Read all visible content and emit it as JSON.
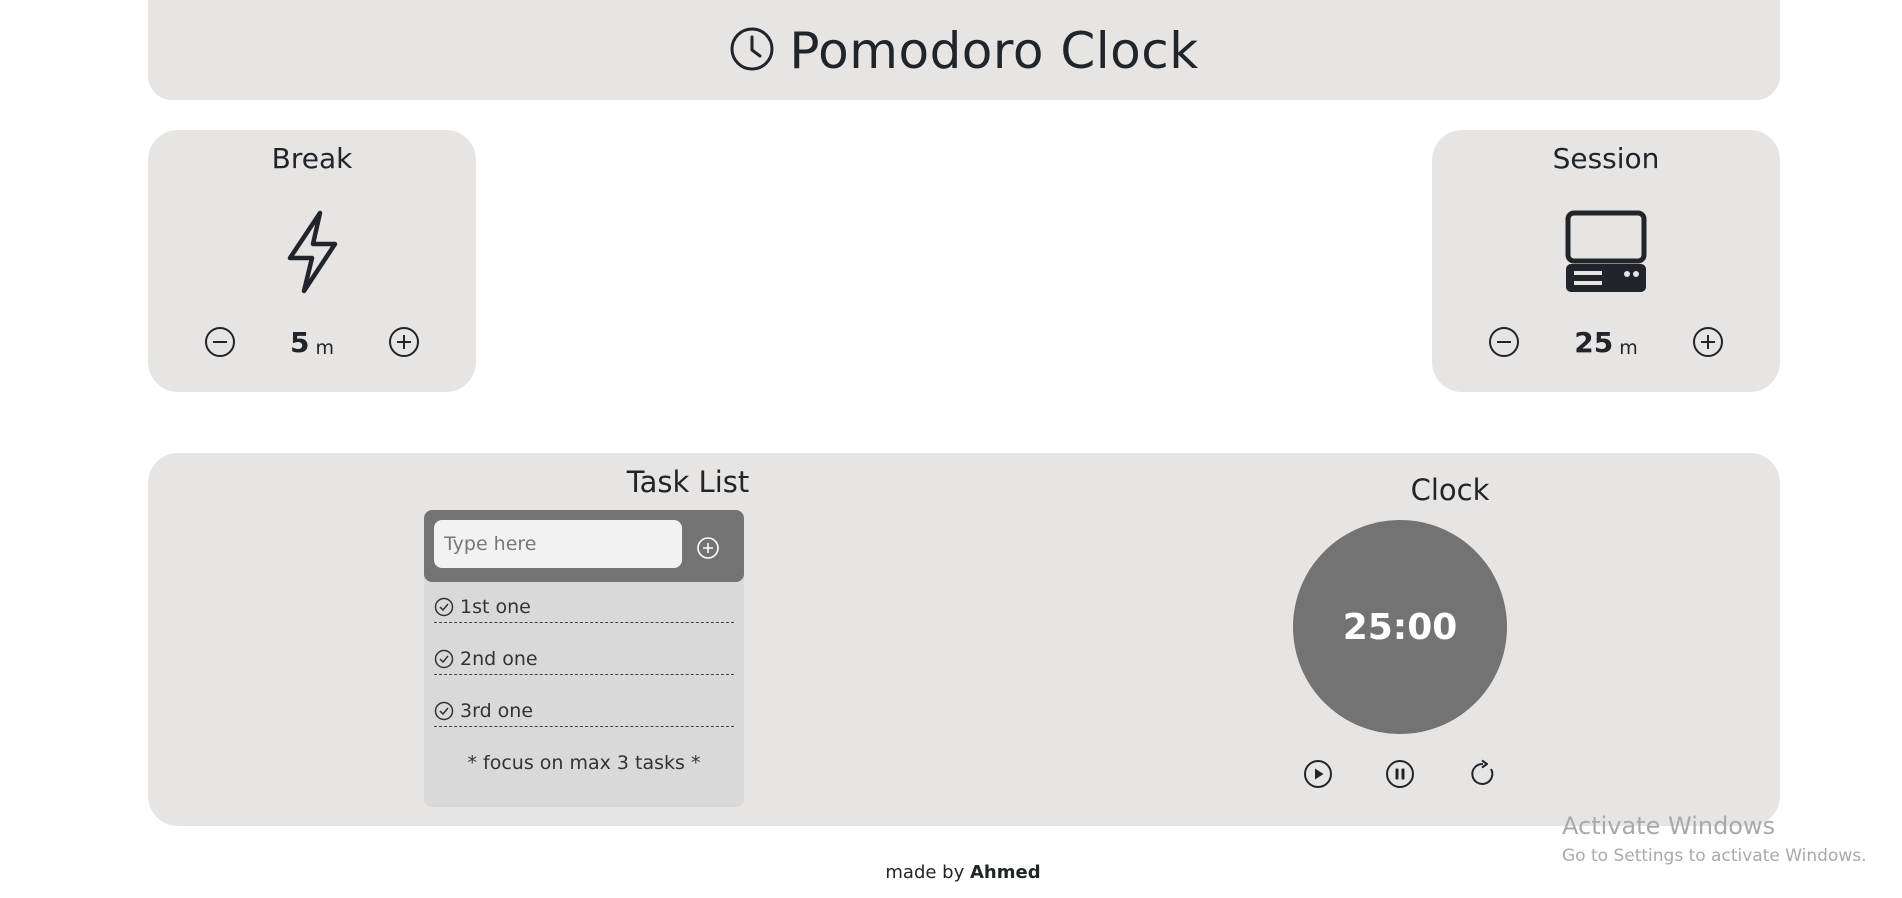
{
  "header": {
    "title": "Pomodoro Clock",
    "icon": "clock-icon"
  },
  "break_card": {
    "title": "Break",
    "icon": "lightning-icon",
    "value": "5",
    "unit": "m",
    "decrement_icon": "minus-circle-icon",
    "increment_icon": "plus-circle-icon"
  },
  "session_card": {
    "title": "Session",
    "icon": "computer-icon",
    "value": "25",
    "unit": "m",
    "decrement_icon": "minus-circle-icon",
    "increment_icon": "plus-circle-icon"
  },
  "tasks": {
    "title": "Task List",
    "input_placeholder": "Type here",
    "input_value": "",
    "add_icon": "plus-circle-icon",
    "items": [
      {
        "label": "1st one",
        "icon": "check-circle-icon"
      },
      {
        "label": "2nd one",
        "icon": "check-circle-icon"
      },
      {
        "label": "3rd one",
        "icon": "check-circle-icon"
      }
    ],
    "note": "* focus on max 3 tasks *"
  },
  "clock": {
    "title": "Clock",
    "time": "25:00",
    "controls": [
      "play-icon",
      "pause-icon",
      "reset-icon"
    ]
  },
  "footer": {
    "prefix": "made by",
    "author": "Ahmed"
  },
  "watermark": {
    "line1": "Activate Windows",
    "line2": "Go to Settings to activate Windows."
  },
  "colors": {
    "panel": "#e6e5e4",
    "dark": "#737373",
    "text": "#212529",
    "task_bg": "#d9d9d9"
  }
}
